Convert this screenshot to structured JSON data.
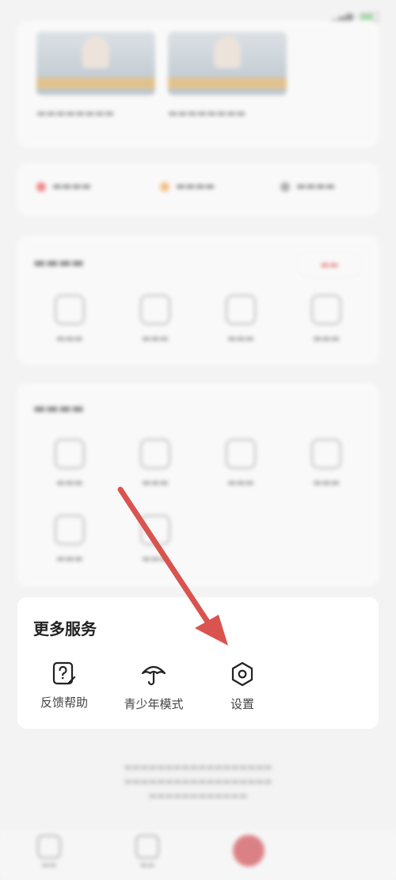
{
  "status_bar": {
    "time": "",
    "battery_color": "#5cc35c"
  },
  "more_services": {
    "title": "更多服务",
    "items": [
      {
        "label": "反馈帮助",
        "icon": "feedback-help-icon"
      },
      {
        "label": "青少年模式",
        "icon": "umbrella-icon"
      },
      {
        "label": "设置",
        "icon": "settings-hexagon-icon"
      }
    ]
  },
  "annotation": {
    "arrow_color": "#d9534f"
  },
  "colors": {
    "accent": "#c8252c",
    "card": "#ffffff",
    "background": "#f3f3f3"
  }
}
